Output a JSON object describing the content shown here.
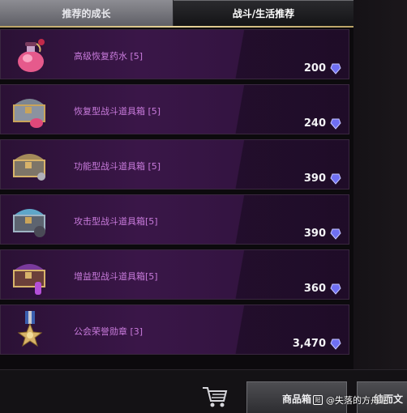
{
  "tabs": [
    {
      "label": "推荐的成长",
      "active": false
    },
    {
      "label": "战斗/生活推荐",
      "active": true
    }
  ],
  "items": [
    {
      "name": "高级恢复药水 [5]",
      "price": "200",
      "icon": "potion-icon"
    },
    {
      "name": "恢复型战斗道具箱 [5]",
      "price": "240",
      "icon": "chest-pink-icon"
    },
    {
      "name": "功能型战斗道具箱 [5]",
      "price": "390",
      "icon": "chest-gold-icon"
    },
    {
      "name": "攻击型战斗道具箱[5]",
      "price": "390",
      "icon": "chest-blue-icon"
    },
    {
      "name": "增益型战斗道具箱[5]",
      "price": "360",
      "icon": "chest-purple-icon"
    },
    {
      "name": "公会荣誉勋章 [3]",
      "price": "3,470",
      "icon": "medal-icon"
    }
  ],
  "bottom": {
    "store_label": "商品箱",
    "next_label": "结而文"
  },
  "watermark": "@失落的方舟吧",
  "colors": {
    "item_name": "#c97bdc",
    "accent_gold": "#e7d49a",
    "gem": "#6f6ff2"
  }
}
